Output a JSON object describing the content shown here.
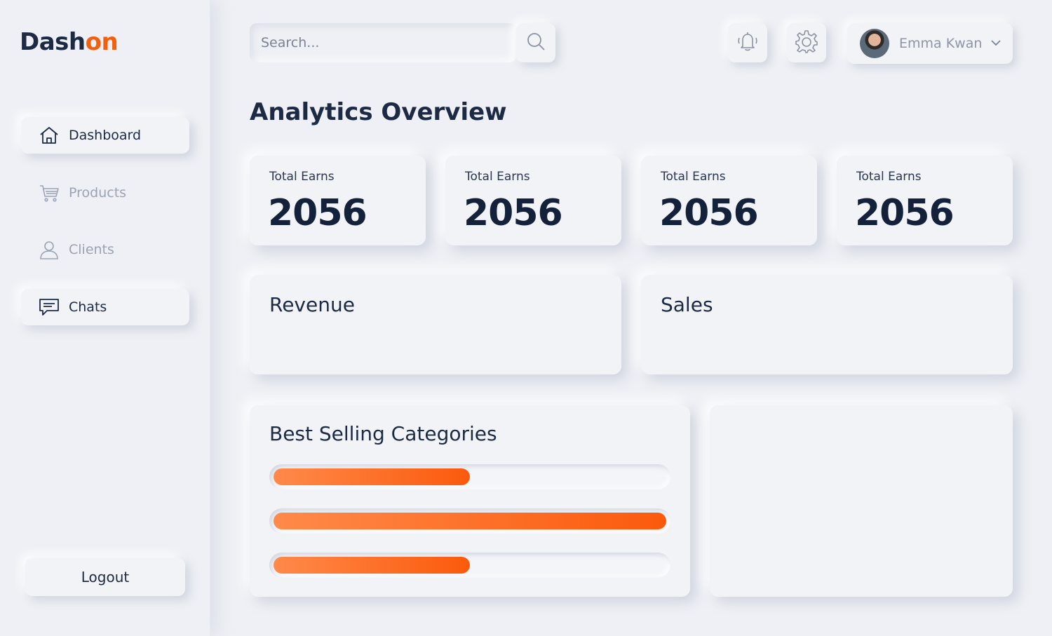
{
  "brand": {
    "part1": "Dash",
    "part2": "on",
    "accent": "#f2600f"
  },
  "sidebar": {
    "items": [
      {
        "label": "Dashboard",
        "icon": "home-icon",
        "state": "active"
      },
      {
        "label": "Products",
        "icon": "cart-icon",
        "state": "muted"
      },
      {
        "label": "Clients",
        "icon": "user-icon",
        "state": "muted"
      },
      {
        "label": "Chats",
        "icon": "chat-icon",
        "state": "raised"
      }
    ],
    "logout_label": "Logout"
  },
  "header": {
    "search_placeholder": "Search...",
    "search_icon": "search-icon",
    "notification_icon": "bell-icon",
    "settings_icon": "gear-icon",
    "user_name": "Emma Kwan",
    "user_menu_icon": "chevron-down-icon"
  },
  "main": {
    "title": "Analytics Overview",
    "stats": [
      {
        "label": "Total Earns",
        "value": "2056"
      },
      {
        "label": "Total Earns",
        "value": "2056"
      },
      {
        "label": "Total Earns",
        "value": "2056"
      },
      {
        "label": "Total Earns",
        "value": "2056"
      }
    ],
    "revenue_title": "Revenue",
    "sales_title": "Sales",
    "categories": {
      "title": "Best Selling Categories",
      "bars": [
        {
          "progress": 0.5
        },
        {
          "progress": 1.0
        },
        {
          "progress": 0.5
        }
      ],
      "bar_colors": [
        "#ff8a4a",
        "#fb5a0c"
      ]
    }
  }
}
